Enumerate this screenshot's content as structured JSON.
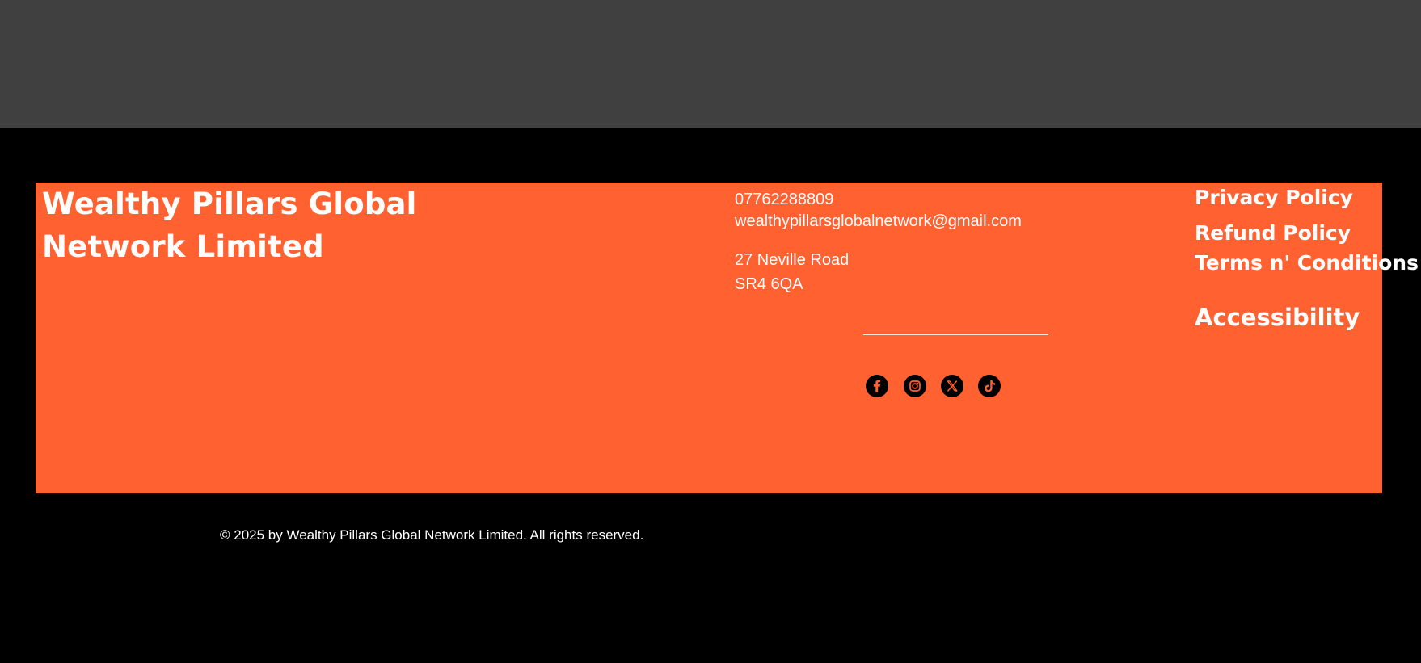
{
  "colors": {
    "top_band": "#404040",
    "page_background": "#000000",
    "footer_panel": "#FF6130",
    "text": "#FFFFFF",
    "social_icon_bg": "#000000",
    "social_icon_glyph": "#FF6130"
  },
  "brand": {
    "line1": "Wealthy Pillars Global",
    "line2": "Network Limited"
  },
  "contact": {
    "phone": "07762288809",
    "email": "wealthypillarsglobalnetwork@gmail.com",
    "address_line1": "27 Neville Road",
    "address_line2": "SR4 6QA"
  },
  "social_links": [
    {
      "icon": "facebook-icon"
    },
    {
      "icon": "instagram-icon"
    },
    {
      "icon": "x-twitter-icon"
    },
    {
      "icon": "tiktok-icon"
    }
  ],
  "policies": {
    "privacy": "Privacy Policy",
    "refund": "Refund Policy",
    "terms": "Terms n' Conditions",
    "accessibility": "Accessibility"
  },
  "copyright": "© 2025 by Wealthy Pillars Global Network Limited. All rights reserved."
}
